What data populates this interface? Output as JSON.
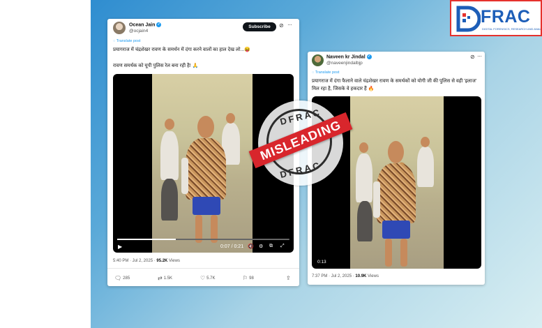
{
  "brand": {
    "logo_text": "FRAC",
    "logo_subtitle": "DIGITAL FORENSICS, RESEARCH AND ANALYTICS CENTRE"
  },
  "stamp": {
    "top_text": "DFRAC",
    "banner_text": "MISLEADING",
    "bottom_text": "DFRAC",
    "banner_color": "#d8262c"
  },
  "tweet1": {
    "name": "Ocean Jain",
    "handle": "@ocjain4",
    "subscribe_label": "Subscribe",
    "translate_label": "Translate post",
    "text_line1": "प्रयागराज में चंद्रशेखर रावण के समर्थन में दंगा करने वालों का हाल देख लो...😝",
    "text_line2": "रावण समर्थक को यूपी पुलिस रेल बना रही है! 🙏",
    "video_time": "0:07 / 0:21",
    "timestamp": "5:40 PM · Jul 2, 2025 · ",
    "views_count": "95.2K",
    "views_label": " Views",
    "replies": "285",
    "reposts": "1.5K",
    "likes": "5.7K",
    "bookmarks": "98"
  },
  "tweet2": {
    "name": "Naveen kr Jindal",
    "handle": "@naveenjindalbjp",
    "translate_label": "Translate post",
    "text": "प्रयागराज में दंगा फैलाने वाले चंद्रशेखर रावण के समर्थकों को योगी जी की पुलिस से वही 'इलाज' मिल रहा है, जिसके वे हकदार हैं 🔥",
    "video_time": "0:13",
    "timestamp": "7:37 PM · Jul 2, 2025 · ",
    "views_count": "10.9K",
    "views_label": " Views"
  },
  "colors": {
    "brand_blue": "#1d5eb8",
    "accent_red": "#e5322d",
    "verified_blue": "#1d9bf0"
  },
  "icons": [
    "play-icon",
    "volume-icon",
    "settings-icon",
    "pip-icon",
    "fullscreen-icon",
    "reply-icon",
    "repost-icon",
    "like-icon",
    "bookmark-icon",
    "share-icon",
    "grok-icon",
    "more-icon",
    "verified-icon",
    "translate-icon"
  ]
}
